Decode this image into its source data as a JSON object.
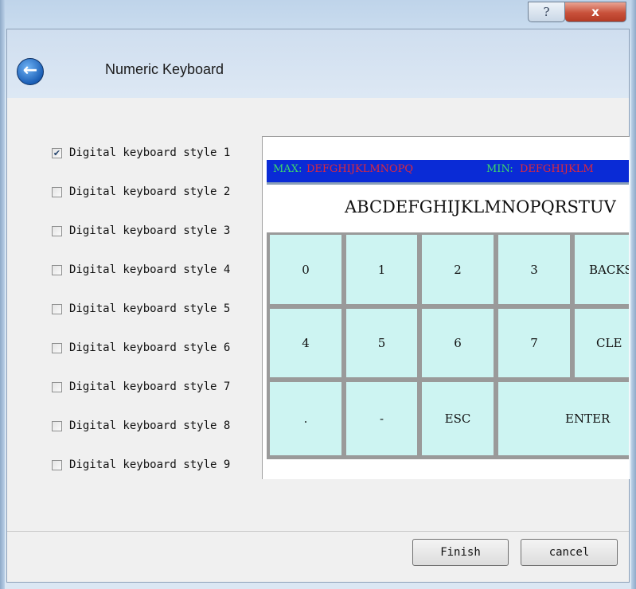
{
  "window": {
    "help_glyph": "?",
    "close_glyph": "x",
    "title": "Numeric Keyboard",
    "back_glyph": "←"
  },
  "styles": [
    {
      "label": "Digital keyboard style 1",
      "checked": true
    },
    {
      "label": "Digital keyboard style 2",
      "checked": false
    },
    {
      "label": "Digital keyboard style 3",
      "checked": false
    },
    {
      "label": "Digital keyboard style 4",
      "checked": false
    },
    {
      "label": "Digital keyboard style 5",
      "checked": false
    },
    {
      "label": "Digital keyboard style 6",
      "checked": false
    },
    {
      "label": "Digital keyboard style 7",
      "checked": false
    },
    {
      "label": "Digital keyboard style 8",
      "checked": false
    },
    {
      "label": "Digital keyboard style 9",
      "checked": false
    }
  ],
  "keyboard": {
    "max_label": "MAX:",
    "max_value": "DEFGHIJKLMNOPQ",
    "min_label": "MIN:",
    "min_value": "DEFGHIJKLM",
    "display": "ABCDEFGHIJKLMNOPQRSTUV",
    "keys": {
      "k0": "0",
      "k1": "1",
      "k2": "2",
      "k3": "3",
      "backspace": "BACKSP",
      "k4": "4",
      "k5": "5",
      "k6": "6",
      "k7": "7",
      "clear": "CLE",
      "dot": ".",
      "minus": "-",
      "esc": "ESC",
      "enter": "ENTER"
    },
    "colors": {
      "key": "#cdf4f2",
      "header": "#0a2bd6",
      "label_green": "#3cd86a",
      "value_red": "#e0283a"
    }
  },
  "buttons": {
    "finish": "Finish",
    "cancel": "cancel"
  }
}
